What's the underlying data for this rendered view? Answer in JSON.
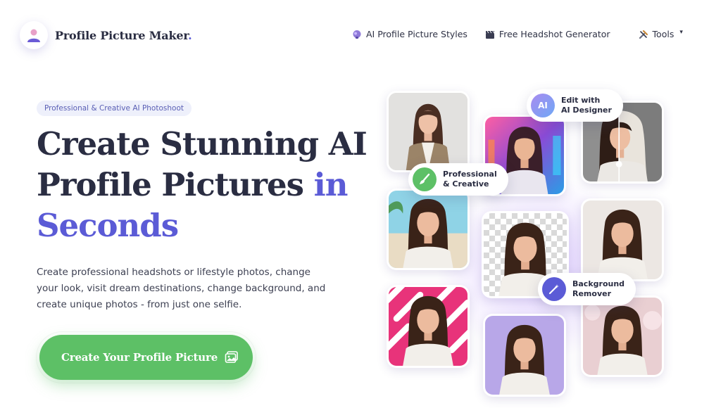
{
  "brand": {
    "name": "Profile Picture Maker",
    "dot": "."
  },
  "nav": {
    "styles_label": "AI Profile Picture Styles",
    "headshot_label": "Free Headshot Generator",
    "tools_label": "Tools",
    "tools_caret": "▾"
  },
  "hero": {
    "pill": "Professional & Creative AI Photoshoot",
    "headline_line1": "Create Stunning AI",
    "headline_line2": "Profile Pictures",
    "headline_accent1": "in",
    "headline_accent2": "Seconds",
    "subtitle": "Create professional headshots or lifestyle photos, change your look, visit dream destinations, change background, and create unique photos - from just one selfie.",
    "cta_label": "Create Your Profile Picture"
  },
  "badges": {
    "designer": {
      "icon_text": "AI",
      "text": "Edit with\nAI Designer"
    },
    "creative": {
      "text": "Professional\n& Creative"
    },
    "remover": {
      "text": "Background\nRemover"
    }
  },
  "colors": {
    "accent": "#5b5bd6",
    "cta": "#5dc066",
    "pill_bg": "#eef0fb"
  },
  "icons": {
    "styles": "brain-icon",
    "headshot": "clapperboard-icon",
    "tools": "tools-icon",
    "cta": "image-icon",
    "creative": "paintbrush-icon",
    "remover": "magic-wand-icon"
  }
}
